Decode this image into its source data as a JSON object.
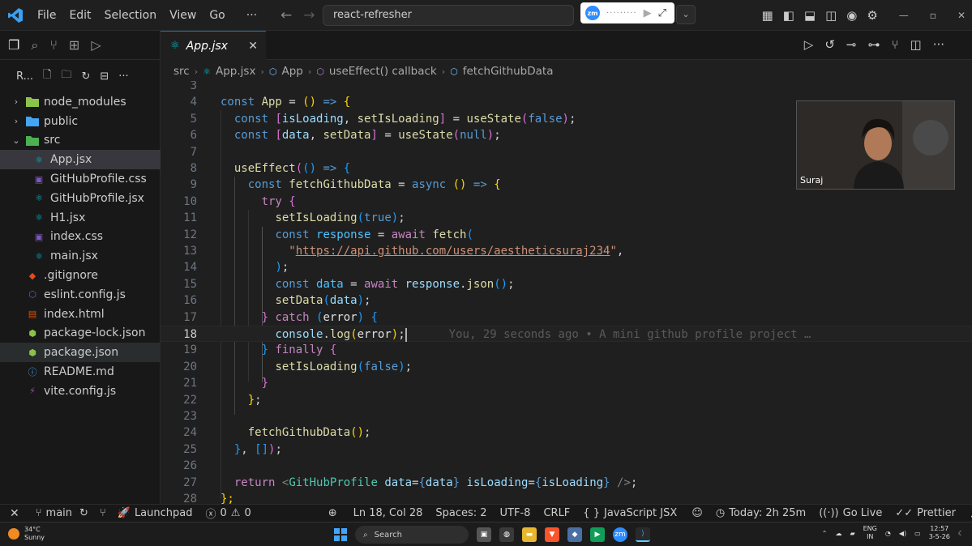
{
  "menu": [
    "File",
    "Edit",
    "Selection",
    "View",
    "Go",
    "···"
  ],
  "command_center": "react-refresher",
  "zoom_logo": "zm",
  "explorer": {
    "title": "R...",
    "tree": [
      {
        "label": "node_modules",
        "kind": "folder",
        "icon": "folder-node-icon",
        "color": "#8bc34a",
        "chevron": "›",
        "indent": 0
      },
      {
        "label": "public",
        "kind": "folder",
        "icon": "folder-public-icon",
        "color": "#42a5f5",
        "chevron": "›",
        "indent": 0
      },
      {
        "label": "src",
        "kind": "folder",
        "icon": "folder-src-icon",
        "color": "#4caf50",
        "chevron": "⌄",
        "indent": 0
      },
      {
        "label": "App.jsx",
        "kind": "file",
        "icon": "react-icon",
        "color": "#00bcd4",
        "indent": 1,
        "selected": true
      },
      {
        "label": "GitHubProfile.css",
        "kind": "file",
        "icon": "css-icon",
        "color": "#7e57c2",
        "indent": 1
      },
      {
        "label": "GitHubProfile.jsx",
        "kind": "file",
        "icon": "react-icon",
        "color": "#00bcd4",
        "indent": 1
      },
      {
        "label": "H1.jsx",
        "kind": "file",
        "icon": "react-icon",
        "color": "#00bcd4",
        "indent": 1
      },
      {
        "label": "index.css",
        "kind": "file",
        "icon": "css-icon",
        "color": "#7e57c2",
        "indent": 1
      },
      {
        "label": "main.jsx",
        "kind": "file",
        "icon": "react-icon",
        "color": "#00bcd4",
        "indent": 1
      },
      {
        "label": ".gitignore",
        "kind": "file",
        "icon": "git-icon",
        "color": "#e64a19",
        "indent": 0
      },
      {
        "label": "eslint.config.js",
        "kind": "file",
        "icon": "eslint-icon",
        "color": "#5c6bc0",
        "indent": 0
      },
      {
        "label": "index.html",
        "kind": "file",
        "icon": "html-icon",
        "color": "#e65100",
        "indent": 0
      },
      {
        "label": "package-lock.json",
        "kind": "file",
        "icon": "nodejs-icon",
        "color": "#8bc34a",
        "indent": 0
      },
      {
        "label": "package.json",
        "kind": "file",
        "icon": "nodejs-icon",
        "color": "#8bc34a",
        "indent": 0,
        "hover": true
      },
      {
        "label": "README.md",
        "kind": "file",
        "icon": "info-icon",
        "color": "#42a5f5",
        "indent": 0
      },
      {
        "label": "vite.config.js",
        "kind": "file",
        "icon": "vite-icon",
        "color": "#ab47bc",
        "indent": 0
      }
    ]
  },
  "tab": {
    "label": "App.jsx",
    "close": "✕"
  },
  "breadcrumb": [
    "src",
    "App.jsx",
    "App",
    "useEffect() callback",
    "fetchGithubData"
  ],
  "code": {
    "current_line": 18,
    "blame": "You, 29 seconds ago • A mini github profile project …",
    "lines": [
      {
        "n": 3,
        "t": []
      },
      {
        "n": 4,
        "t": [
          [
            "kw",
            "const "
          ],
          [
            "fn",
            "App"
          ],
          [
            "pu",
            " = "
          ],
          [
            "p1",
            "()"
          ],
          [
            "pu",
            " "
          ],
          [
            "kw",
            "=>"
          ],
          [
            "pu",
            " "
          ],
          [
            "p1",
            "{"
          ]
        ]
      },
      {
        "n": 5,
        "t": [
          [
            "pu",
            "  "
          ],
          [
            "kw",
            "const "
          ],
          [
            "p2",
            "["
          ],
          [
            "vr",
            "isLoading"
          ],
          [
            "pu",
            ", "
          ],
          [
            "fn",
            "setIsLoading"
          ],
          [
            "p2",
            "]"
          ],
          [
            "pu",
            " = "
          ],
          [
            "fn",
            "useState"
          ],
          [
            "p2",
            "("
          ],
          [
            "kw",
            "false"
          ],
          [
            "p2",
            ")"
          ],
          [
            "pu",
            ";"
          ]
        ]
      },
      {
        "n": 6,
        "t": [
          [
            "pu",
            "  "
          ],
          [
            "kw",
            "const "
          ],
          [
            "p2",
            "["
          ],
          [
            "vr",
            "data"
          ],
          [
            "pu",
            ", "
          ],
          [
            "fn",
            "setData"
          ],
          [
            "p2",
            "]"
          ],
          [
            "pu",
            " = "
          ],
          [
            "fn",
            "useState"
          ],
          [
            "p2",
            "("
          ],
          [
            "kw",
            "null"
          ],
          [
            "p2",
            ")"
          ],
          [
            "pu",
            ";"
          ]
        ]
      },
      {
        "n": 7,
        "t": []
      },
      {
        "n": 8,
        "t": [
          [
            "pu",
            "  "
          ],
          [
            "fn",
            "useEffect"
          ],
          [
            "p2",
            "("
          ],
          [
            "p3",
            "()"
          ],
          [
            "pu",
            " "
          ],
          [
            "kw",
            "=>"
          ],
          [
            "pu",
            " "
          ],
          [
            "p3",
            "{"
          ]
        ]
      },
      {
        "n": 9,
        "t": [
          [
            "pu",
            "    "
          ],
          [
            "kw",
            "const "
          ],
          [
            "fn",
            "fetchGithubData"
          ],
          [
            "pu",
            " = "
          ],
          [
            "kw",
            "async "
          ],
          [
            "p1",
            "()"
          ],
          [
            "pu",
            " "
          ],
          [
            "kw",
            "=>"
          ],
          [
            "pu",
            " "
          ],
          [
            "p1",
            "{"
          ]
        ]
      },
      {
        "n": 10,
        "t": [
          [
            "pu",
            "      "
          ],
          [
            "kw2",
            "try "
          ],
          [
            "p2",
            "{"
          ]
        ]
      },
      {
        "n": 11,
        "t": [
          [
            "pu",
            "        "
          ],
          [
            "fn",
            "setIsLoading"
          ],
          [
            "p3",
            "("
          ],
          [
            "kw",
            "true"
          ],
          [
            "p3",
            ")"
          ],
          [
            "pu",
            ";"
          ]
        ]
      },
      {
        "n": 12,
        "t": [
          [
            "pu",
            "        "
          ],
          [
            "kw",
            "const "
          ],
          [
            "ct",
            "response"
          ],
          [
            "pu",
            " = "
          ],
          [
            "kw2",
            "await "
          ],
          [
            "fn",
            "fetch"
          ],
          [
            "p3",
            "("
          ]
        ]
      },
      {
        "n": 13,
        "t": [
          [
            "pu",
            "          "
          ],
          [
            "str",
            "\""
          ],
          [
            "url",
            "https://api.github.com/users/aestheticsuraj234"
          ],
          [
            "str",
            "\""
          ],
          [
            "pu",
            ","
          ]
        ]
      },
      {
        "n": 14,
        "t": [
          [
            "pu",
            "        "
          ],
          [
            "p3",
            ")"
          ],
          [
            "pu",
            ";"
          ]
        ]
      },
      {
        "n": 15,
        "t": [
          [
            "pu",
            "        "
          ],
          [
            "kw",
            "const "
          ],
          [
            "ct",
            "data"
          ],
          [
            "pu",
            " = "
          ],
          [
            "kw2",
            "await "
          ],
          [
            "vr",
            "response"
          ],
          [
            "pu",
            "."
          ],
          [
            "fn",
            "json"
          ],
          [
            "p3",
            "()"
          ],
          [
            "pu",
            ";"
          ]
        ]
      },
      {
        "n": 16,
        "t": [
          [
            "pu",
            "        "
          ],
          [
            "fn",
            "setData"
          ],
          [
            "p3",
            "("
          ],
          [
            "vr",
            "data"
          ],
          [
            "p3",
            ")"
          ],
          [
            "pu",
            ";"
          ]
        ]
      },
      {
        "n": 17,
        "t": [
          [
            "pu",
            "      "
          ],
          [
            "p2",
            "}"
          ],
          [
            "pu",
            " "
          ],
          [
            "kw2",
            "catch "
          ],
          [
            "p3",
            "("
          ],
          [
            "wm",
            "error"
          ],
          [
            "p3",
            ")"
          ],
          [
            "pu",
            " "
          ],
          [
            "p3",
            "{"
          ]
        ]
      },
      {
        "n": 18,
        "t": [
          [
            "pu",
            "        "
          ],
          [
            "vr",
            "console"
          ],
          [
            "pu",
            "."
          ],
          [
            "fn",
            "log"
          ],
          [
            "p1",
            "("
          ],
          [
            "wm",
            "error"
          ],
          [
            "p1",
            ")"
          ],
          [
            "pu",
            ";"
          ]
        ]
      },
      {
        "n": 19,
        "t": [
          [
            "pu",
            "      "
          ],
          [
            "p3",
            "}"
          ],
          [
            "pu",
            " "
          ],
          [
            "kw2",
            "finally "
          ],
          [
            "p2",
            "{"
          ]
        ]
      },
      {
        "n": 20,
        "t": [
          [
            "pu",
            "        "
          ],
          [
            "fn",
            "setIsLoading"
          ],
          [
            "p3",
            "("
          ],
          [
            "kw",
            "false"
          ],
          [
            "p3",
            ")"
          ],
          [
            "pu",
            ";"
          ]
        ]
      },
      {
        "n": 21,
        "t": [
          [
            "pu",
            "      "
          ],
          [
            "p2",
            "}"
          ]
        ]
      },
      {
        "n": 22,
        "t": [
          [
            "pu",
            "    "
          ],
          [
            "p1",
            "}"
          ],
          [
            "pu",
            ";"
          ]
        ]
      },
      {
        "n": 23,
        "t": []
      },
      {
        "n": 24,
        "t": [
          [
            "pu",
            "    "
          ],
          [
            "fn",
            "fetchGithubData"
          ],
          [
            "p1",
            "()"
          ],
          [
            "pu",
            ";"
          ]
        ]
      },
      {
        "n": 25,
        "t": [
          [
            "pu",
            "  "
          ],
          [
            "p3",
            "}"
          ],
          [
            "pu",
            ", "
          ],
          [
            "p3",
            "[]"
          ],
          [
            "p2",
            ")"
          ],
          [
            "pu",
            ";"
          ]
        ]
      },
      {
        "n": 26,
        "t": []
      },
      {
        "n": 27,
        "t": [
          [
            "pu",
            "  "
          ],
          [
            "kw2",
            "return "
          ],
          [
            "br",
            "<"
          ],
          [
            "tag",
            "GitHubProfile"
          ],
          [
            "pu",
            " "
          ],
          [
            "vr",
            "data"
          ],
          [
            "pu",
            "="
          ],
          [
            "kw",
            "{"
          ],
          [
            "vr",
            "data"
          ],
          [
            "kw",
            "}"
          ],
          [
            "pu",
            " "
          ],
          [
            "vr",
            "isLoading"
          ],
          [
            "pu",
            "="
          ],
          [
            "kw",
            "{"
          ],
          [
            "vr",
            "isLoading"
          ],
          [
            "kw",
            "}"
          ],
          [
            "pu",
            " "
          ],
          [
            "br",
            "/>"
          ],
          [
            "pu",
            ";"
          ]
        ]
      },
      {
        "n": 28,
        "t": [
          [
            "p1",
            "};"
          ]
        ]
      }
    ]
  },
  "webcam": {
    "name": "Suraj"
  },
  "statusbar": {
    "branch": "main",
    "launchpad": "Launchpad",
    "errors": "0",
    "warnings": "0",
    "position": "Ln 18, Col 28",
    "spaces": "Spaces: 2",
    "encoding": "UTF-8",
    "eol": "CRLF",
    "language": "JavaScript JSX",
    "time": "Today: 2h 25m",
    "golive": "Go Live",
    "prettier": "Prettier"
  },
  "taskbar": {
    "temp": "34°C",
    "weather": "Sunny",
    "search": "Search",
    "lang1": "ENG",
    "lang2": "IN",
    "time": "12:57",
    "date": "3-5-26"
  }
}
